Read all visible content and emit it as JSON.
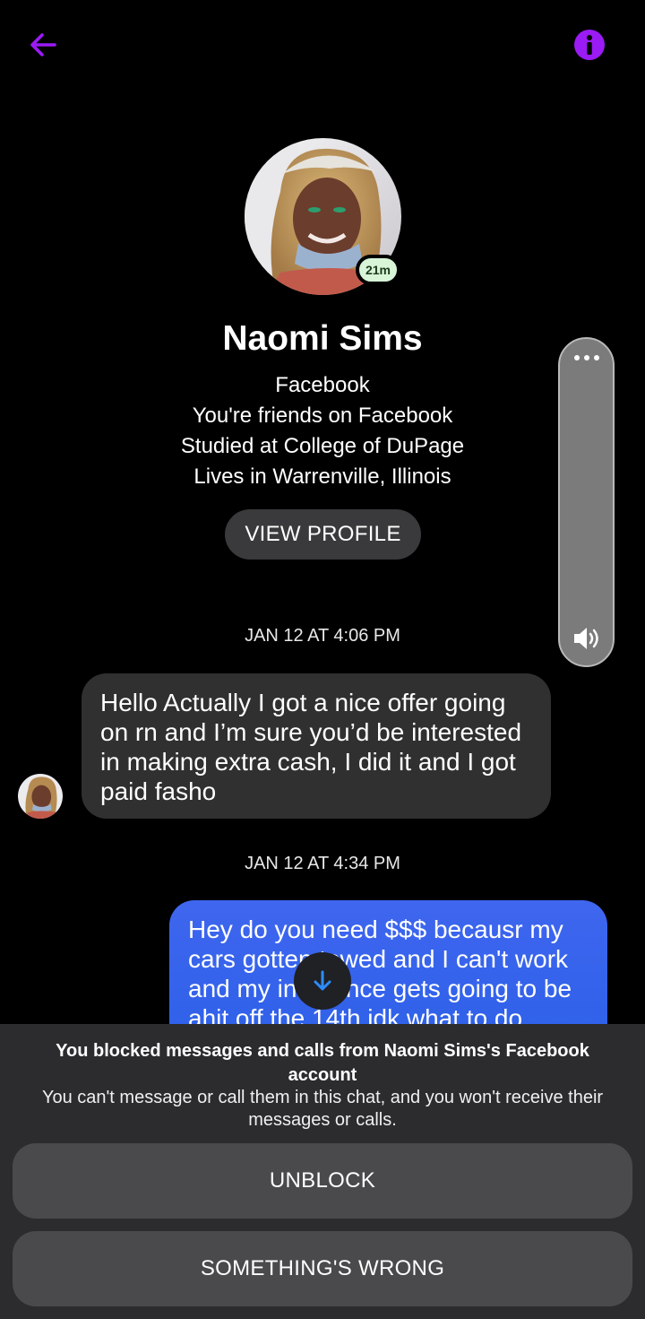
{
  "colors": {
    "accent": "#9b1bf5",
    "background": "#000000",
    "incoming_bubble": "#303030",
    "outgoing_bubble": "#3360ee",
    "active_badge": "#d8f5d8"
  },
  "header": {
    "back_icon": "arrow-left-icon",
    "info_icon": "info-icon"
  },
  "profile": {
    "active_badge": "21m",
    "name": "Naomi Sims",
    "lines": [
      "Facebook",
      "You're friends on Facebook",
      "Studied at College of DuPage",
      "Lives in Warrenville, Illinois"
    ],
    "view_profile_label": "VIEW PROFILE"
  },
  "conversation": {
    "timestamp_1": "JAN 12 AT 4:06 PM",
    "incoming_message": "Hello Actually I got a nice offer going on rn and I’m sure you’d be interested in making extra cash, I did it and I got paid fasho",
    "timestamp_2": "JAN 12 AT 4:34 PM",
    "outgoing_message": "Hey do you need $$$ becausr my cars gotten towed and I can't work and my insurance gets going to be ahit off the 14th idk what to do"
  },
  "volume_overlay": {
    "more_icon": "more-dots-icon",
    "speaker_icon": "speaker-icon"
  },
  "blocked_panel": {
    "title": "You blocked messages and calls from Naomi Sims's Facebook account",
    "description": "You can't message or call them in this chat, and you won't receive their messages or calls.",
    "unblock_label": "UNBLOCK",
    "something_wrong_label": "SOMETHING'S WRONG"
  }
}
